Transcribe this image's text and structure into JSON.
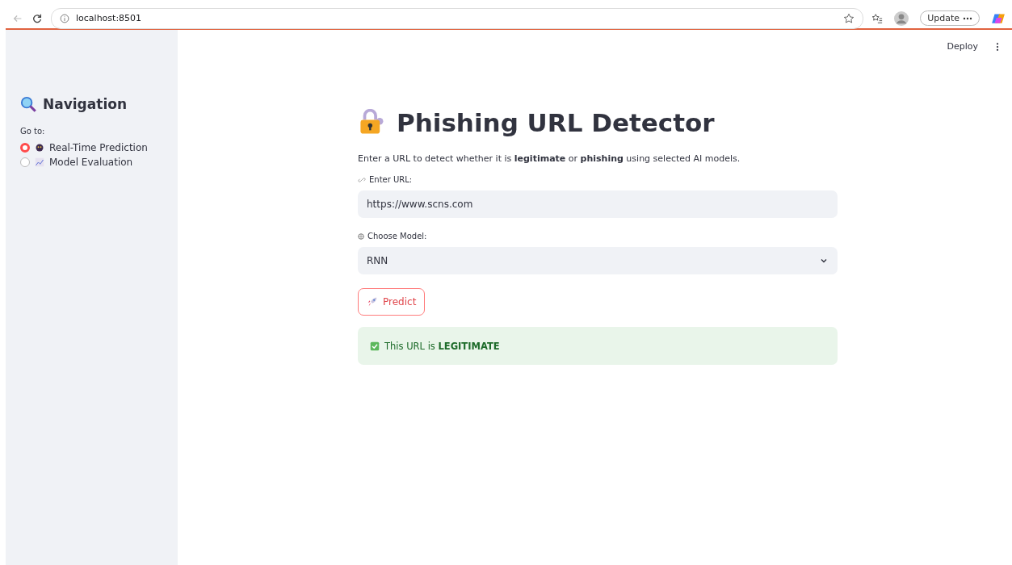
{
  "browser": {
    "address": "localhost:8501",
    "update_button": "Update"
  },
  "header": {
    "deploy": "Deploy"
  },
  "sidebar": {
    "title": "Navigation",
    "radio_label": "Go to:",
    "options": [
      {
        "label": "Real-Time Prediction",
        "selected": true
      },
      {
        "label": "Model Evaluation",
        "selected": false
      }
    ]
  },
  "main": {
    "title": "Phishing URL Detector",
    "intro": "Enter a URL to detect whether it is **legitimate** or **phishing** using selected AI models.",
    "url_label": "Enter URL:",
    "url_value": "https://www.scns.com",
    "model_label": "Choose Model:",
    "model_value": "RNN",
    "predict_button": "Predict",
    "result": "This URL is **LEGITIMATE**"
  }
}
